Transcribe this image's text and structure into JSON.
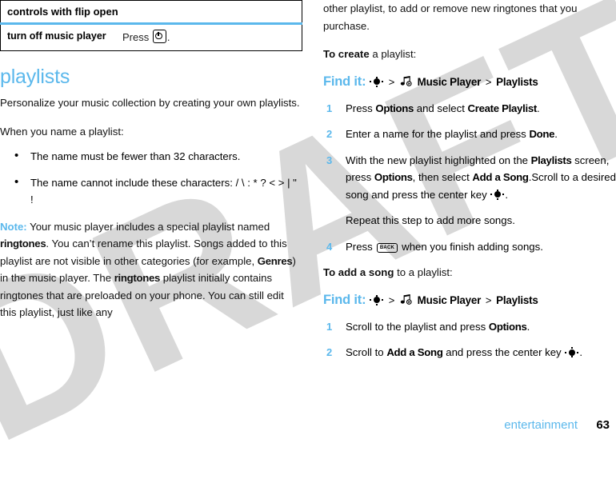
{
  "watermark": {
    "text": "DRAFT"
  },
  "left_column": {
    "table": {
      "header": "controls with flip open",
      "rows": [
        {
          "label": "turn off music player",
          "value_prefix": "Press",
          "value_icon": "power-key-icon",
          "value_suffix": "."
        }
      ]
    },
    "heading": "playlists",
    "intro": "Personalize your music collection by creating your own playlists.",
    "naming_lead": "When you name a playlist:",
    "bullets": [
      "The name must be fewer than 32 characters.",
      "The name cannot include these characters: / \\ : * ? < > | \" !"
    ],
    "note": {
      "label": "Note:",
      "part1": " Your music player includes a special playlist named ",
      "term1": "ringtones",
      "part2": ". You can’t rename this playlist. Songs added to this playlist are not visible in other categories (for example, ",
      "term2": "Genres",
      "part3": ") in the music player. The ",
      "term3": "ringtones",
      "part4": " playlist initially contains ringtones that are preloaded on your phone. You can still edit this playlist, just like any"
    }
  },
  "right_column": {
    "continuation": "other playlist, to add or remove new ringtones that you purchase.",
    "create_section": {
      "lead_bold": "To create",
      "lead_rest": " a playlist:",
      "findit": {
        "label": "Find it:",
        "nav_icon": "navigation-key-icon",
        "sep1": ">",
        "music_icon": "music-player-icon",
        "item1": "Music Player",
        "sep2": ">",
        "item2": "Playlists"
      },
      "steps": [
        {
          "num": "1",
          "segments": [
            {
              "t": "Press ",
              "b": false
            },
            {
              "t": "Options",
              "b": true
            },
            {
              "t": " and select ",
              "b": false
            },
            {
              "t": "Create Playlist",
              "b": true
            },
            {
              "t": ".",
              "b": false
            }
          ]
        },
        {
          "num": "2",
          "segments": [
            {
              "t": "Enter a name for the playlist and press ",
              "b": false
            },
            {
              "t": "Done",
              "b": true
            },
            {
              "t": ".",
              "b": false
            }
          ]
        },
        {
          "num": "3",
          "segments": [
            {
              "t": "With the new playlist highlighted on the ",
              "b": false
            },
            {
              "t": "Playlists",
              "b": true
            },
            {
              "t": " screen, press ",
              "b": false
            },
            {
              "t": "Options",
              "b": true
            },
            {
              "t": ", then select ",
              "b": false
            },
            {
              "t": "Add a Song",
              "b": true
            },
            {
              "t": ".Scroll to a desired song and press the center key ",
              "b": false
            }
          ],
          "trailing_icon": "navigation-key-icon",
          "trailing_text": ".",
          "sub_para": "Repeat this step to add more songs."
        },
        {
          "num": "4",
          "segments": [
            {
              "t": "Press ",
              "b": false
            }
          ],
          "mid_icon": "back-key-icon",
          "mid_icon_label": "BACK",
          "segments_after": [
            {
              "t": " when you finish adding songs.",
              "b": false
            }
          ]
        }
      ]
    },
    "add_section": {
      "lead_bold": "To add a song",
      "lead_rest": " to a playlist:",
      "findit": {
        "label": "Find it:",
        "nav_icon": "navigation-key-icon",
        "sep1": ">",
        "music_icon": "music-player-icon",
        "item1": "Music Player",
        "sep2": ">",
        "item2": "Playlists"
      },
      "steps": [
        {
          "num": "1",
          "segments": [
            {
              "t": "Scroll to the playlist and press ",
              "b": false
            },
            {
              "t": "Options",
              "b": true
            },
            {
              "t": ".",
              "b": false
            }
          ]
        },
        {
          "num": "2",
          "segments": [
            {
              "t": "Scroll to ",
              "b": false
            },
            {
              "t": "Add a Song",
              "b": true
            },
            {
              "t": " and press the center key ",
              "b": false
            }
          ],
          "trailing_icon": "navigation-key-icon",
          "trailing_text": "."
        }
      ]
    }
  },
  "footer": {
    "chapter": "entertainment",
    "page_number": "63"
  },
  "colors": {
    "accent_blue": "#5bb8ec",
    "text_black": "#000000",
    "watermark_gray": "#d8d8d8"
  }
}
